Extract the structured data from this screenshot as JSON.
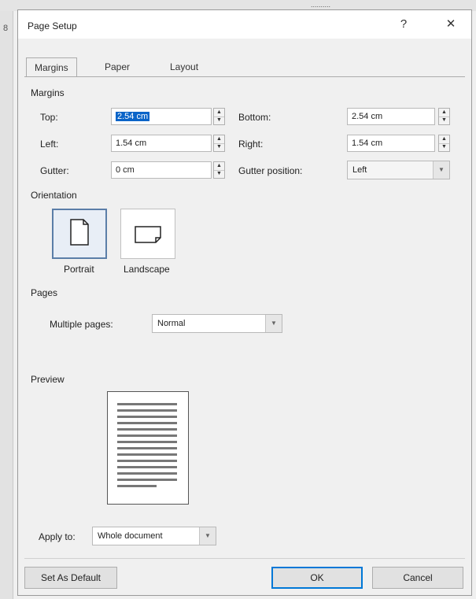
{
  "window": {
    "title": "Page Setup",
    "help": "?",
    "close": "✕"
  },
  "background": {
    "doc_text": "..........",
    "side_number": "8"
  },
  "tabs": [
    {
      "label": "Margins",
      "active": true
    },
    {
      "label": "Paper",
      "active": false
    },
    {
      "label": "Layout",
      "active": false
    }
  ],
  "margins": {
    "group_label": "Margins",
    "top": {
      "label": "Top:",
      "value": "2.54 cm"
    },
    "bottom": {
      "label": "Bottom:",
      "value": "2.54 cm"
    },
    "left": {
      "label": "Left:",
      "value": "1.54 cm"
    },
    "right": {
      "label": "Right:",
      "value": "1.54 cm"
    },
    "gutter": {
      "label": "Gutter:",
      "value": "0 cm"
    },
    "gutter_position": {
      "label": "Gutter position:",
      "value": "Left"
    }
  },
  "orientation": {
    "group_label": "Orientation",
    "portrait": "Portrait",
    "landscape": "Landscape",
    "selected": "portrait"
  },
  "pages": {
    "group_label": "Pages",
    "multiple_pages_label": "Multiple pages:",
    "multiple_pages_value": "Normal"
  },
  "preview": {
    "group_label": "Preview"
  },
  "apply_to": {
    "label": "Apply to:",
    "value": "Whole document"
  },
  "buttons": {
    "set_default": "Set As Default",
    "ok": "OK",
    "cancel": "Cancel"
  },
  "colors": {
    "accent": "#0078d7",
    "selection": "#0a64c8"
  }
}
